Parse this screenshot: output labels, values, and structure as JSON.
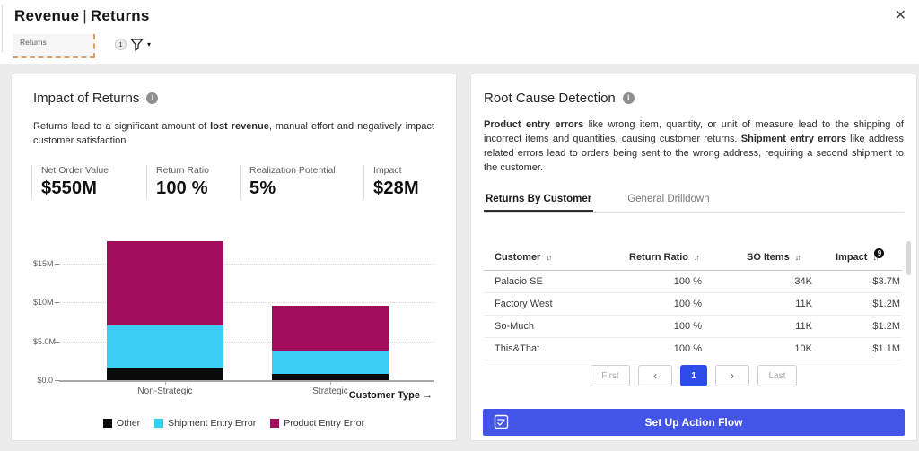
{
  "header": {
    "title_primary": "Revenue",
    "title_separator": "|",
    "title_secondary": "Returns",
    "filter_tab": {
      "label": "Returns",
      "badge": "1"
    }
  },
  "icons": {
    "close": "✕",
    "caret": "▾",
    "info": "i"
  },
  "left_panel": {
    "title": "Impact of Returns",
    "description": [
      {
        "t": "Returns lead to a significant amount of ",
        "b": 0
      },
      {
        "t": "lost revenue",
        "b": 1
      },
      {
        "t": ", manual effort and negatively impact customer satisfaction.",
        "b": 0
      }
    ],
    "kpis": [
      {
        "label": "Net Order Value",
        "value": "$550M"
      },
      {
        "label": "Return Ratio",
        "value": "100 %"
      },
      {
        "label": "Realization Potential",
        "value": "5%"
      },
      {
        "label": "Impact",
        "value": "$28M"
      }
    ],
    "x_axis_title": "Customer Type →"
  },
  "chart_data": {
    "type": "bar",
    "stacked": true,
    "categories": [
      "Non-Strategic",
      "Strategic"
    ],
    "series": [
      {
        "name": "Other",
        "color": "#0a0a0a",
        "values": [
          1.6,
          0.8
        ]
      },
      {
        "name": "Shipment Entry Error",
        "color": "#3bcdf2",
        "values": [
          5.4,
          3.0
        ]
      },
      {
        "name": "Product Entry Error",
        "color": "#a30b5d",
        "values": [
          10.8,
          5.8
        ]
      }
    ],
    "totals_musd": [
      17.8,
      9.6
    ],
    "y_ticks": [
      {
        "label": "$15M",
        "value": 15
      },
      {
        "label": "$10M",
        "value": 10
      },
      {
        "label": "$5.0M",
        "value": 5
      },
      {
        "label": "$0.0",
        "value": 0
      }
    ],
    "ylim": [
      0,
      19
    ],
    "xlabel": "Customer Type",
    "grid": "dotted-horizontal",
    "legend_position": "bottom",
    "units": "USD millions"
  },
  "right_panel": {
    "title": "Root Cause Detection",
    "description": [
      {
        "t": "Product entry errors",
        "b": 1
      },
      {
        "t": " like wrong item, quantity, or unit of measure lead to the shipping of incorrect items and quantities, causing customer returns. ",
        "b": 0
      },
      {
        "t": "Shipment entry errors",
        "b": 1
      },
      {
        "t": " like address related errors lead to orders being sent to the wrong address, requiring a second shipment to the customer.",
        "b": 0
      }
    ],
    "tabs": [
      {
        "label": "Returns By Customer",
        "active": true
      },
      {
        "label": "General Drilldown",
        "active": false
      }
    ],
    "table": {
      "columns": [
        {
          "label": "Customer",
          "sort": "↓↑"
        },
        {
          "label": "Return Ratio",
          "sort": "↓↑"
        },
        {
          "label": "SO Items",
          "sort": "↓↑"
        },
        {
          "label": "Impact",
          "sort": "↓↑",
          "badge": "9"
        }
      ],
      "rows": [
        {
          "customer": "Palacio SE",
          "return_ratio": "100 %",
          "so_items": "34K",
          "impact": "$3.7M"
        },
        {
          "customer": "Factory West",
          "return_ratio": "100 %",
          "so_items": "11K",
          "impact": "$1.2M"
        },
        {
          "customer": "So-Much",
          "return_ratio": "100 %",
          "so_items": "11K",
          "impact": "$1.2M"
        },
        {
          "customer": "This&That",
          "return_ratio": "100 %",
          "so_items": "10K",
          "impact": "$1.1M"
        }
      ]
    },
    "pagination": [
      {
        "label": "First",
        "type": "first"
      },
      {
        "label": "‹",
        "type": "prev"
      },
      {
        "label": "1",
        "type": "page",
        "active": true
      },
      {
        "label": "›",
        "type": "next"
      },
      {
        "label": "Last",
        "type": "last"
      }
    ],
    "cta": "Set Up Action Flow"
  },
  "colors": {
    "accent_blue": "#4355e8",
    "pagination_active": "#2b4ce8",
    "tab_accent_orange": "#dd9f66",
    "bar_black": "#0a0a0a",
    "bar_cyan": "#3bcdf2",
    "bar_magenta": "#a30b5d",
    "band_gray": "#ececec"
  }
}
